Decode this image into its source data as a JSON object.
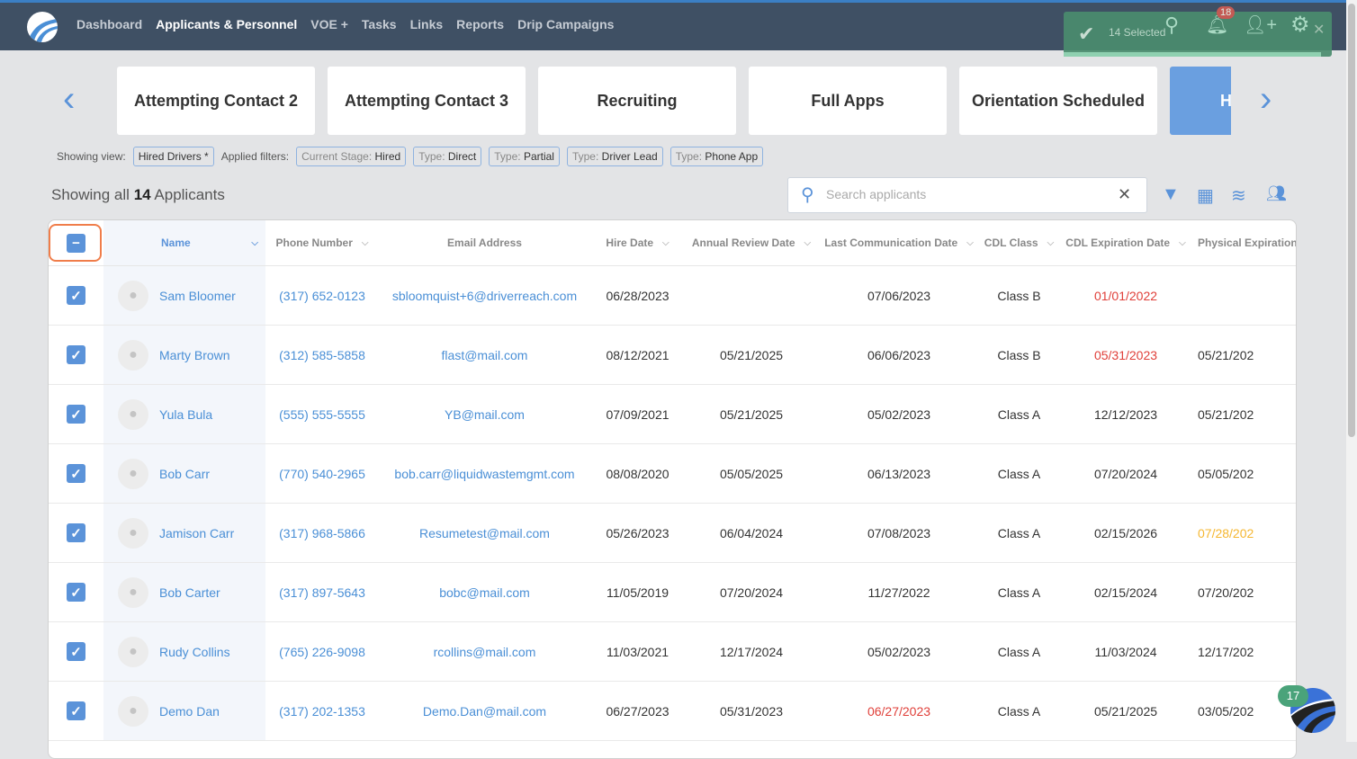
{
  "nav": {
    "items": [
      "Dashboard",
      "Applicants & Personnel",
      "VOE +",
      "Tasks",
      "Links",
      "Reports",
      "Drip Campaigns"
    ],
    "active": "Applicants & Personnel"
  },
  "toast": {
    "text": "14 Selected",
    "notifications": "18"
  },
  "stages": [
    "Attempting Contact 2",
    "Attempting Contact 3",
    "Recruiting",
    "Full Apps",
    "Orientation Scheduled",
    "H"
  ],
  "filters": {
    "view_label": "Showing view:",
    "view": "Hired Drivers *",
    "applied_label": "Applied filters:",
    "chips": [
      {
        "k": "Current Stage:",
        "v": "Hired"
      },
      {
        "k": "Type:",
        "v": "Direct"
      },
      {
        "k": "Type:",
        "v": "Partial"
      },
      {
        "k": "Type:",
        "v": "Driver Lead"
      },
      {
        "k": "Type:",
        "v": "Phone App"
      }
    ]
  },
  "summary": {
    "prefix": "Showing all",
    "count": "14",
    "suffix": "Applicants"
  },
  "search": {
    "placeholder": "Search applicants",
    "value": ""
  },
  "colors": {
    "accent": "#5b93d9",
    "overdue": "#e0403a",
    "warning": "#f5b731",
    "toast": "#4a8c6e"
  },
  "columns": [
    "Name",
    "Phone Number",
    "Email Address",
    "Hire Date",
    "Annual Review Date",
    "Last Communication Date",
    "CDL Class",
    "CDL Expiration Date",
    "Physical Expiration"
  ],
  "rows": [
    [
      "Sam Bloomer",
      "(317) 652-0123",
      "sbloomquist+6@driverreach.com",
      "06/28/2023",
      "",
      "07/06/2023",
      "Class B",
      "01/01/2022",
      ""
    ],
    [
      "Marty Brown",
      "(312) 585-5858",
      "flast@mail.com",
      "08/12/2021",
      "05/21/2025",
      "06/06/2023",
      "Class B",
      "05/31/2023",
      "05/21/202"
    ],
    [
      "Yula Bula",
      "(555) 555-5555",
      "YB@mail.com",
      "07/09/2021",
      "05/21/2025",
      "05/02/2023",
      "Class A",
      "12/12/2023",
      "05/21/202"
    ],
    [
      "Bob Carr",
      "(770) 540-2965",
      "bob.carr@liquidwastemgmt.com",
      "08/08/2020",
      "05/05/2025",
      "06/13/2023",
      "Class A",
      "07/20/2024",
      "05/05/202"
    ],
    [
      "Jamison Carr",
      "(317) 968-5866",
      "Resumetest@mail.com",
      "05/26/2023",
      "06/04/2024",
      "07/08/2023",
      "Class A",
      "02/15/2026",
      "07/28/202"
    ],
    [
      "Bob Carter",
      "(317) 897-5643",
      "bobc@mail.com",
      "11/05/2019",
      "07/20/2024",
      "11/27/2022",
      "Class A",
      "02/15/2024",
      "07/20/202"
    ],
    [
      "Rudy Collins",
      "(765) 226-9098",
      "rcollins@mail.com",
      "11/03/2021",
      "12/17/2024",
      "05/02/2023",
      "Class A",
      "11/03/2024",
      "12/17/202"
    ],
    [
      "Demo Dan",
      "(317) 202-1353",
      "Demo.Dan@mail.com",
      "06/27/2023",
      "05/31/2023",
      "06/27/2023",
      "Class A",
      "05/21/2025",
      "03/05/202"
    ]
  ],
  "highlights": {
    "0-7": "red",
    "1-7": "red",
    "7-5": "red",
    "4-8": "orange"
  },
  "chat": {
    "badge": "17"
  }
}
